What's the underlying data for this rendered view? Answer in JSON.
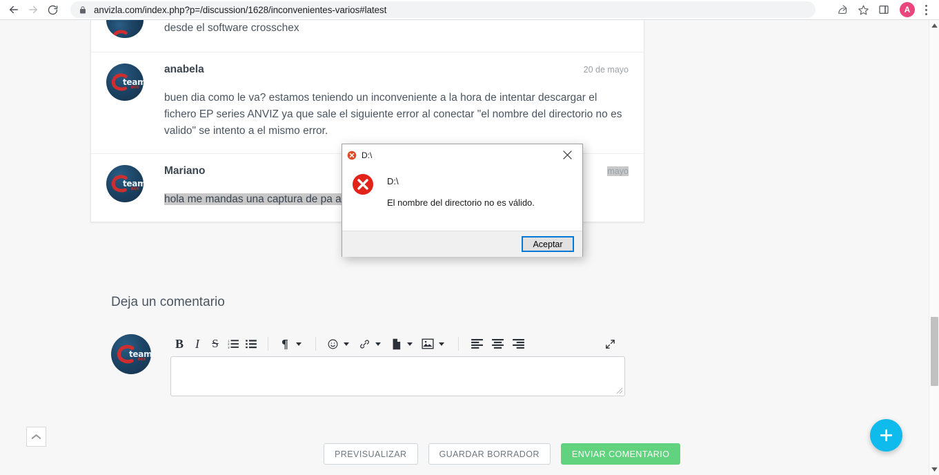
{
  "browser": {
    "back_label": "Back",
    "forward_label": "Forward",
    "reload_label": "Reload",
    "url_prefix": "anvizla.com",
    "url_suffix": "/index.php?p=/discussion/1628/inconvenientes-varios#latest",
    "url_full": "anvizla.com/index.php?p=/discussion/1628/inconvenientes-varios#latest",
    "profile_initial": "A",
    "profile_color": "#e8467c"
  },
  "page": {
    "comments": [
      {
        "author": "",
        "date": "",
        "text": "desde el software crosschex",
        "selected": false,
        "partial_top": true
      },
      {
        "author": "anabela",
        "date": "20 de mayo",
        "text": "buen dia como le va? estamos teniendo un inconveniente a la hora de intentar descargar el fichero EP series ANVIZ ya que sale el siguiente error al conectar \"el nombre del directorio no es valido\" se intento a                                el mismo error.",
        "selected": false,
        "partial_top": false
      },
      {
        "author": "Mariano",
        "date": "mayo",
        "text": "hola me mandas una captura de pa                                                                a Base.",
        "selected": true,
        "partial_top": false
      }
    ],
    "composer": {
      "heading": "Deja un comentario",
      "textarea_value": "",
      "textarea_placeholder": "",
      "toolbar": [
        {
          "name": "bold-icon",
          "label": "B"
        },
        {
          "name": "italic-icon",
          "label": "I"
        },
        {
          "name": "strikethrough-icon",
          "label": "S"
        },
        {
          "name": "ordered-list-icon",
          "label": "Ordered list"
        },
        {
          "name": "unordered-list-icon",
          "label": "Unordered list"
        },
        {
          "name": "paragraph-format-icon",
          "label": "¶"
        },
        {
          "name": "emoji-icon",
          "label": "Emoji"
        },
        {
          "name": "link-icon",
          "label": "Link"
        },
        {
          "name": "file-icon",
          "label": "File"
        },
        {
          "name": "image-icon",
          "label": "Image"
        },
        {
          "name": "align-left-icon",
          "label": "Align left"
        },
        {
          "name": "align-center-icon",
          "label": "Align center"
        },
        {
          "name": "align-right-icon",
          "label": "Align right"
        },
        {
          "name": "expand-icon",
          "label": "Fullscreen"
        }
      ],
      "buttons": {
        "preview": "PREVISUALIZAR",
        "save_draft": "GUARDAR BORRADOR",
        "submit": "ENVIAR COMENTARIO",
        "submit_color": "#61d27e"
      }
    },
    "scroll_top_label": "Volver arriba",
    "fab_label": "+"
  },
  "dialog": {
    "title": "D:\\",
    "path": "D:\\",
    "message": "El nombre del directorio no es válido.",
    "ok_button": "Aceptar",
    "close_label": "Cerrar",
    "accent_color": "#0078d7",
    "error_color": "#e81123"
  }
}
